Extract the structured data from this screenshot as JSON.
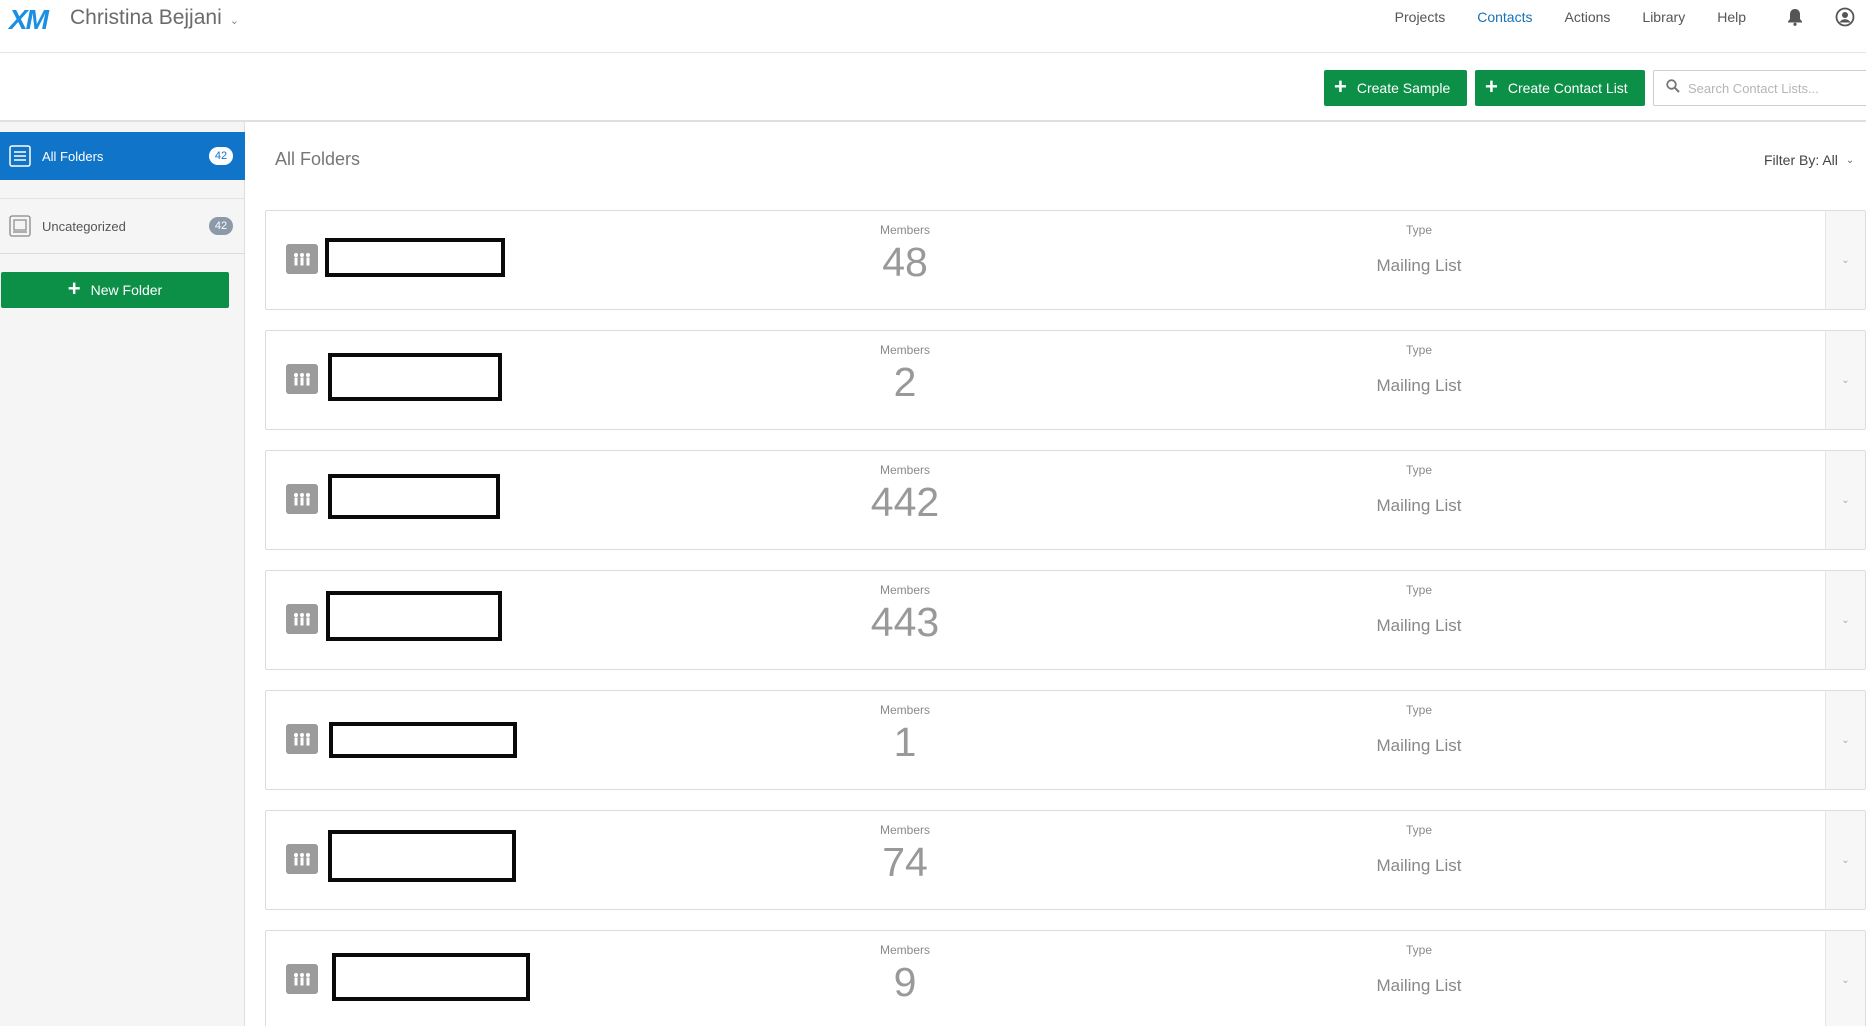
{
  "topnav": {
    "logo": "XM",
    "user_name": "Christina Bejjani",
    "links": [
      {
        "label": "Projects",
        "active": false
      },
      {
        "label": "Contacts",
        "active": true
      },
      {
        "label": "Actions",
        "active": false
      },
      {
        "label": "Library",
        "active": false
      },
      {
        "label": "Help",
        "active": false
      }
    ],
    "icons": [
      "bell-icon",
      "account-icon"
    ]
  },
  "toolbar": {
    "create_sample_label": "Create Sample",
    "create_contact_list_label": "Create Contact List",
    "search_placeholder": "Search Contact Lists..."
  },
  "sidebar": {
    "items": [
      {
        "label": "All Folders",
        "count": "42",
        "active": true
      },
      {
        "label": "Uncategorized",
        "count": "42",
        "active": false
      }
    ],
    "new_folder_label": "New Folder"
  },
  "main": {
    "title": "All Folders",
    "filter_label": "Filter By: All",
    "rows": [
      {
        "members_label": "Members",
        "members": "48",
        "type_label": "Type",
        "type": "Mailing List"
      },
      {
        "members_label": "Members",
        "members": "2",
        "type_label": "Type",
        "type": "Mailing List"
      },
      {
        "members_label": "Members",
        "members": "442",
        "type_label": "Type",
        "type": "Mailing List"
      },
      {
        "members_label": "Members",
        "members": "443",
        "type_label": "Type",
        "type": "Mailing List"
      },
      {
        "members_label": "Members",
        "members": "1",
        "type_label": "Type",
        "type": "Mailing List"
      },
      {
        "members_label": "Members",
        "members": "74",
        "type_label": "Type",
        "type": "Mailing List"
      },
      {
        "members_label": "Members",
        "members": "9",
        "type_label": "Type",
        "type": "Mailing List"
      }
    ]
  },
  "colors": {
    "brand_blue": "#1075c8",
    "action_green": "#0c9048",
    "active_link": "#1672b9"
  }
}
